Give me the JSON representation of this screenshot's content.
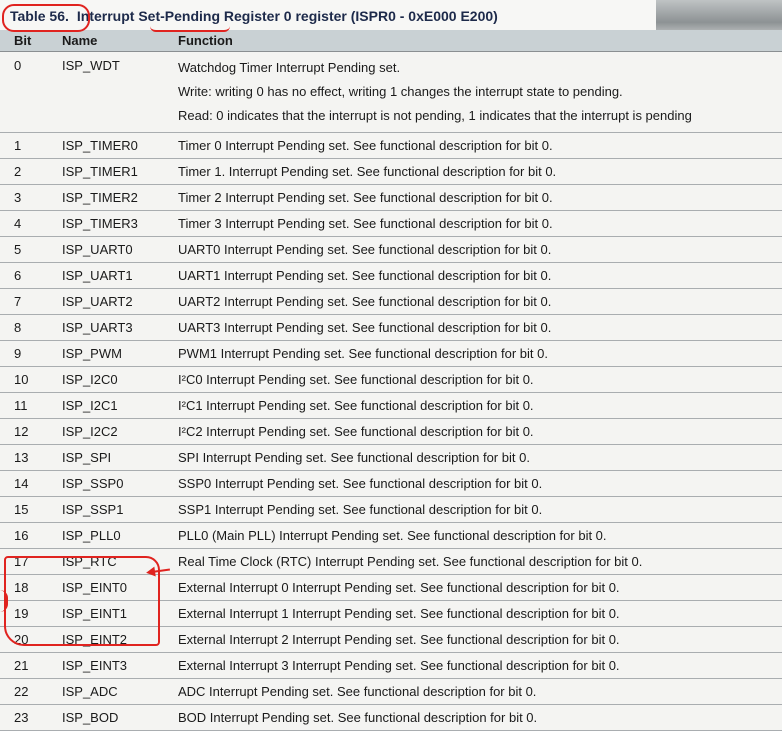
{
  "caption": {
    "table_number": "Table 56.",
    "title": "Interrupt Set-Pending Register 0 register (ISPR0 - 0xE000 E200)"
  },
  "columns": [
    "Bit",
    "Name",
    "Function"
  ],
  "rows": [
    {
      "bit": "0",
      "name": "ISP_WDT",
      "function": [
        "Watchdog Timer Interrupt Pending set.",
        "Write: writing 0 has no effect, writing 1 changes the interrupt state to pending.",
        "Read: 0 indicates that the interrupt is not pending, 1 indicates that the interrupt is pending"
      ]
    },
    {
      "bit": "1",
      "name": "ISP_TIMER0",
      "function": [
        "Timer 0 Interrupt Pending set. See functional description for bit 0."
      ]
    },
    {
      "bit": "2",
      "name": "ISP_TIMER1",
      "function": [
        "Timer 1. Interrupt Pending set. See functional description for bit 0."
      ]
    },
    {
      "bit": "3",
      "name": "ISP_TIMER2",
      "function": [
        "Timer 2 Interrupt Pending set. See functional description for bit 0."
      ]
    },
    {
      "bit": "4",
      "name": "ISP_TIMER3",
      "function": [
        "Timer 3 Interrupt Pending set. See functional description for bit 0."
      ]
    },
    {
      "bit": "5",
      "name": "ISP_UART0",
      "function": [
        "UART0 Interrupt Pending set. See functional description for bit 0."
      ]
    },
    {
      "bit": "6",
      "name": "ISP_UART1",
      "function": [
        "UART1 Interrupt Pending set. See functional description for bit 0."
      ]
    },
    {
      "bit": "7",
      "name": "ISP_UART2",
      "function": [
        "UART2 Interrupt Pending set. See functional description for bit 0."
      ]
    },
    {
      "bit": "8",
      "name": "ISP_UART3",
      "function": [
        "UART3 Interrupt Pending set. See functional description for bit 0."
      ]
    },
    {
      "bit": "9",
      "name": "ISP_PWM",
      "function": [
        "PWM1 Interrupt Pending set. See functional description for bit 0."
      ]
    },
    {
      "bit": "10",
      "name": "ISP_I2C0",
      "function": [
        "I²C0 Interrupt Pending set. See functional description for bit 0."
      ]
    },
    {
      "bit": "11",
      "name": "ISP_I2C1",
      "function": [
        "I²C1 Interrupt Pending set. See functional description for bit 0."
      ]
    },
    {
      "bit": "12",
      "name": "ISP_I2C2",
      "function": [
        "I²C2 Interrupt Pending set. See functional description for bit 0."
      ]
    },
    {
      "bit": "13",
      "name": "ISP_SPI",
      "function": [
        "SPI Interrupt Pending set. See functional description for bit 0."
      ]
    },
    {
      "bit": "14",
      "name": "ISP_SSP0",
      "function": [
        "SSP0 Interrupt Pending set. See functional description for bit 0."
      ]
    },
    {
      "bit": "15",
      "name": "ISP_SSP1",
      "function": [
        "SSP1 Interrupt Pending set. See functional description for bit 0."
      ]
    },
    {
      "bit": "16",
      "name": "ISP_PLL0",
      "function": [
        "PLL0 (Main PLL) Interrupt Pending set. See functional description for bit 0."
      ]
    },
    {
      "bit": "17",
      "name": "ISP_RTC",
      "function": [
        "Real Time Clock (RTC) Interrupt Pending set. See functional description for bit 0."
      ]
    },
    {
      "bit": "18",
      "name": "ISP_EINT0",
      "function": [
        "External Interrupt 0 Interrupt Pending set. See functional description for bit 0."
      ]
    },
    {
      "bit": "19",
      "name": "ISP_EINT1",
      "function": [
        "External Interrupt 1 Interrupt Pending set. See functional description for bit 0."
      ]
    },
    {
      "bit": "20",
      "name": "ISP_EINT2",
      "function": [
        "External Interrupt 2 Interrupt Pending set. See functional description for bit 0."
      ]
    },
    {
      "bit": "21",
      "name": "ISP_EINT3",
      "function": [
        "External Interrupt 3 Interrupt Pending set. See functional description for bit 0."
      ]
    },
    {
      "bit": "22",
      "name": "ISP_ADC",
      "function": [
        "ADC Interrupt Pending set. See functional description for bit 0."
      ]
    },
    {
      "bit": "23",
      "name": "ISP_BOD",
      "function": [
        "BOD Interrupt Pending set. See functional description for bit 0."
      ]
    }
  ],
  "colors": {
    "annotation": "#e0231f",
    "header_bg": "#c9d1d4",
    "caption_text": "#1d2a4a"
  }
}
